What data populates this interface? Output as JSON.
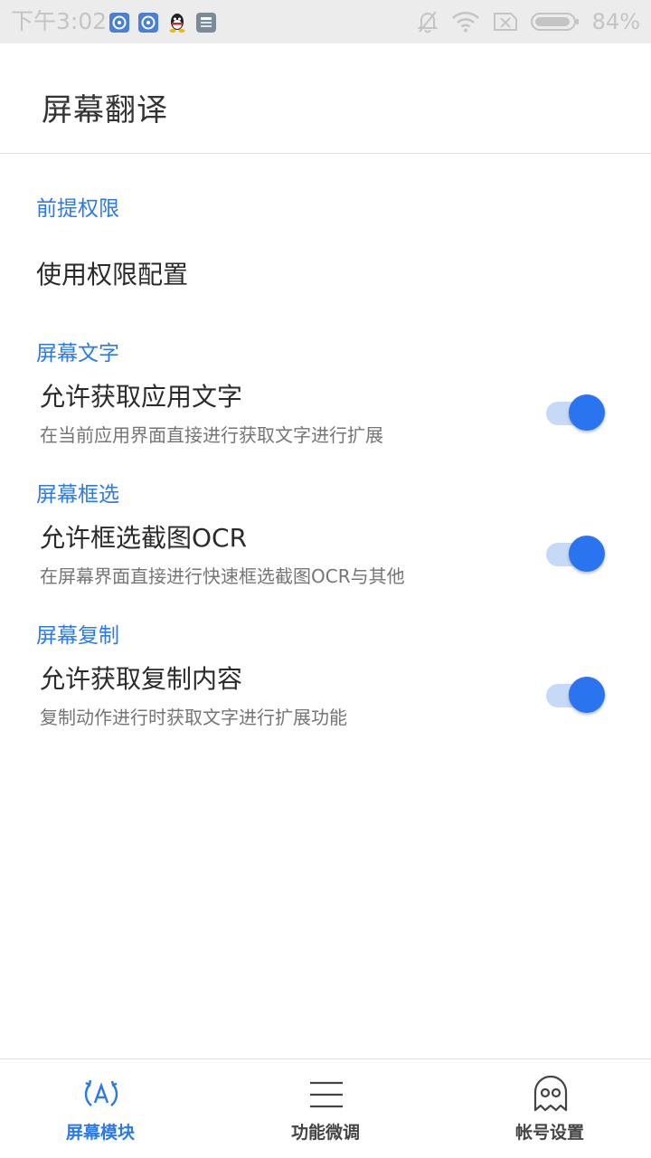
{
  "status_bar": {
    "time": "下午3:02",
    "battery_percent": "84%",
    "notification_icons": [
      "app-notification-icon",
      "app-notification-icon",
      "qq-icon",
      "sim-card-icon"
    ]
  },
  "header": {
    "title": "屏幕翻译"
  },
  "sections": {
    "prerequisite": {
      "header": "前提权限",
      "item_label": "使用权限配置"
    },
    "screen_text": {
      "header": "屏幕文字",
      "title": "允许获取应用文字",
      "description": "在当前应用界面直接进行获取文字进行扩展",
      "enabled": true
    },
    "screen_select": {
      "header": "屏幕框选",
      "title": "允许框选截图OCR",
      "description": "在屏幕界面直接进行快速框选截图OCR与其他",
      "enabled": true
    },
    "screen_copy": {
      "header": "屏幕复制",
      "title": "允许获取复制内容",
      "description": "复制动作进行时获取文字进行扩展功能",
      "enabled": true
    }
  },
  "bottom_nav": {
    "items": [
      {
        "label": "屏幕模块",
        "icon": "translate-a-icon",
        "active": true
      },
      {
        "label": "功能微调",
        "icon": "menu-lines-icon",
        "active": false
      },
      {
        "label": "帐号设置",
        "icon": "ghost-icon",
        "active": false
      }
    ]
  },
  "colors": {
    "accent": "#2b7ae8",
    "switch_track": "#c6daf8",
    "switch_thumb": "#2b74f0",
    "nav_inactive": "#444444",
    "status_bar_bg": "#ececec"
  }
}
